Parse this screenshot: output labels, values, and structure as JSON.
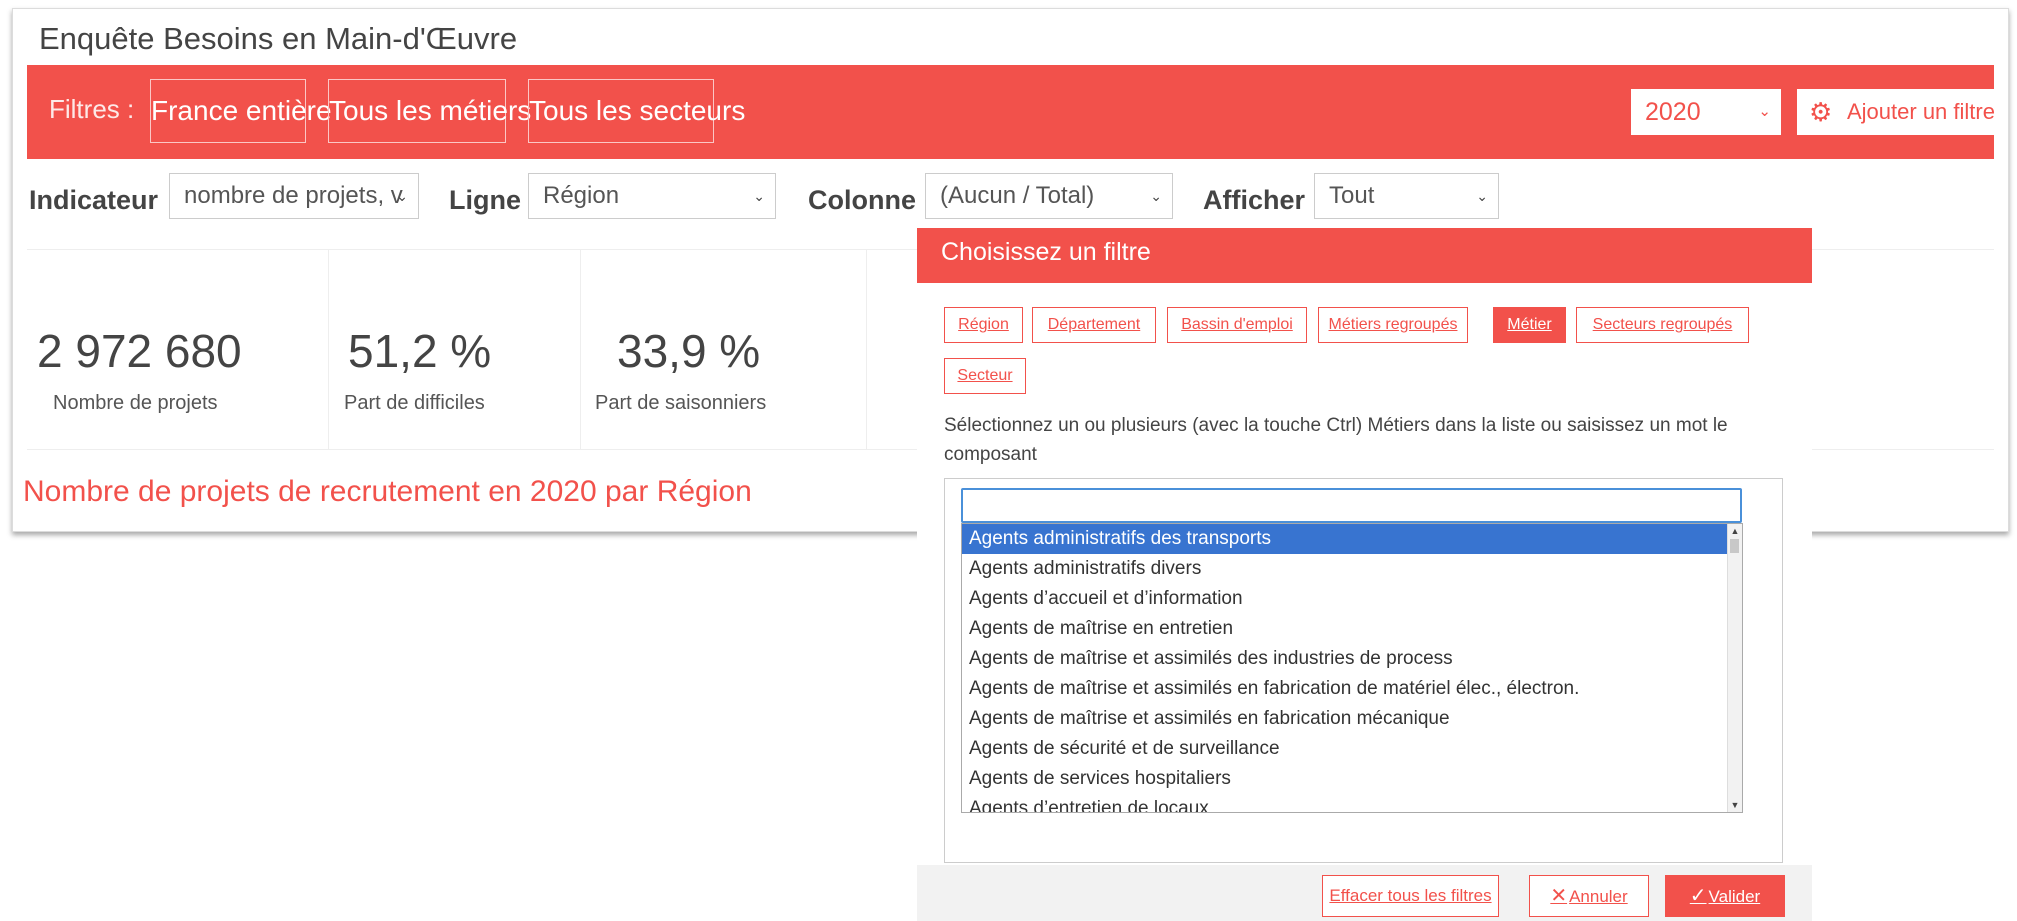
{
  "app": {
    "title": "Enquête Besoins en Main-d'Œuvre"
  },
  "filterbar": {
    "label": "Filtres :",
    "buttons": [
      "France entière",
      "Tous les métiers",
      "Tous les secteurs"
    ],
    "year": "2020",
    "add_filter": "Ajouter un filtre",
    "colors": {
      "accent": "#f2514b"
    }
  },
  "controls": {
    "indicateur": {
      "label": "Indicateur",
      "value": "nombre de projets, v"
    },
    "ligne": {
      "label": "Ligne",
      "value": "Région"
    },
    "colonne": {
      "label": "Colonne",
      "value": "(Aucun / Total)"
    },
    "afficher": {
      "label": "Afficher",
      "value": "Tout"
    }
  },
  "stats": [
    {
      "value": "2 972 680",
      "label": "Nombre de projets"
    },
    {
      "value": "51,2 %",
      "label": "Part de difficiles"
    },
    {
      "value": "33,9 %",
      "label": "Part de saisonniers"
    }
  ],
  "chart_title": "Nombre de projets de recrutement en 2020 par Région",
  "modal": {
    "title": "Choisissez un filtre",
    "chips": [
      "Région",
      "Département",
      "Bassin d'emploi",
      "Métiers regroupés",
      "Métier",
      "Secteurs regroupés",
      "Secteur"
    ],
    "active_chip": "Métier",
    "help": "Sélectionnez un ou plusieurs (avec la touche Ctrl) Métiers dans la liste ou saisissez un mot le composant",
    "search_value": "",
    "options": [
      "Agents administratifs des transports",
      "Agents administratifs divers",
      "Agents d’accueil et d’information",
      "Agents de maîtrise en entretien",
      "Agents de maîtrise et assimilés des industries de process",
      "Agents de maîtrise et assimilés en fabrication de matériel élec., électron.",
      "Agents de maîtrise et assimilés en fabrication mécanique",
      "Agents de sécurité et de surveillance",
      "Agents de services hospitaliers",
      "Agents d’entretien de locaux"
    ],
    "selected_option": "Agents administratifs des transports",
    "footer": {
      "clear": "Effacer tous les filtres",
      "cancel": "Annuler",
      "validate": "Valider"
    }
  }
}
